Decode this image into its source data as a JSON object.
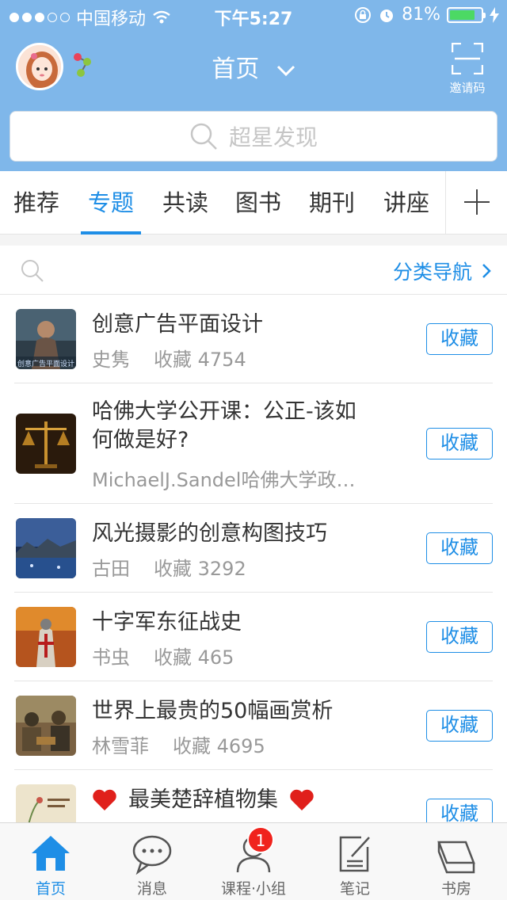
{
  "status_bar": {
    "carrier": "中国移动",
    "time": "下午5:27",
    "battery_percent": "81%",
    "battery_level": 0.81,
    "signal_dots_filled": 3,
    "signal_dots_total": 5
  },
  "header": {
    "title": "首页",
    "invite_label": "邀请码",
    "search_placeholder": "超星发现"
  },
  "tabs": [
    {
      "label": "推荐"
    },
    {
      "label": "专题"
    },
    {
      "label": "共读"
    },
    {
      "label": "图书"
    },
    {
      "label": "期刊"
    },
    {
      "label": "讲座"
    }
  ],
  "active_tab": "专题",
  "filter": {
    "nav_label": "分类导航"
  },
  "items": [
    {
      "title": "创意广告平面设计",
      "author": "史隽",
      "collect_label": "收藏",
      "collect_count": "4754",
      "button": "收藏",
      "thumb_text": "创意广告平面设计"
    },
    {
      "title": "哈佛大学公开课：公正-该如何做是好?",
      "subtitle": "MichaelJ.Sandel哈佛大学政…",
      "button": "收藏"
    },
    {
      "title": "风光摄影的创意构图技巧",
      "author": "古田",
      "collect_label": "收藏",
      "collect_count": "3292",
      "button": "收藏"
    },
    {
      "title": "十字军东征战史",
      "author": "书虫",
      "collect_label": "收藏",
      "collect_count": "465",
      "button": "收藏"
    },
    {
      "title": "世界上最贵的50幅画赏析",
      "author": "林雪菲",
      "collect_label": "收藏",
      "collect_count": "4695",
      "button": "收藏"
    },
    {
      "title": "最美楚辞植物集",
      "button": "收藏"
    }
  ],
  "bottom_tabs": [
    {
      "label": "首页",
      "icon": "home-icon"
    },
    {
      "label": "消息",
      "icon": "message-icon"
    },
    {
      "label": "课程·小组",
      "icon": "person-icon",
      "badge": "1"
    },
    {
      "label": "笔记",
      "icon": "note-icon"
    },
    {
      "label": "书房",
      "icon": "bookshelf-icon"
    }
  ],
  "colors": {
    "header_bg": "#7fb7ea",
    "accent": "#1e8ee6",
    "badge": "#f0231d",
    "heart": "#e0201b"
  }
}
